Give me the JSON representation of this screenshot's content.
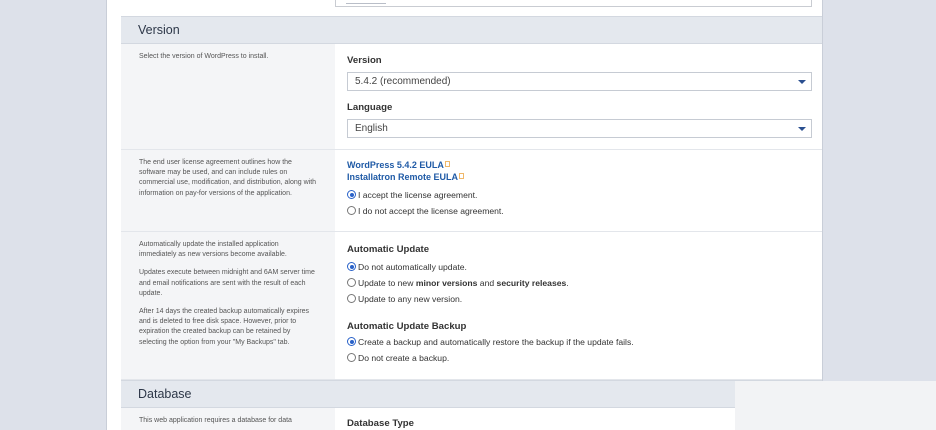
{
  "version_section": {
    "title": "Version",
    "description": "Select the version of WordPress to install.",
    "version_label": "Version",
    "version_value": "5.4.2 (recommended)",
    "language_label": "Language",
    "language_value": "English"
  },
  "license": {
    "description": "The end user license agreement outlines how the software may be used, and can include rules on commercial use, modification, and distribution, along with information on pay-for versions of the application.",
    "eula_link": "WordPress 5.4.2 EULA",
    "remote_eula_link": "Installatron Remote EULA",
    "accept": "I accept the license agreement.",
    "decline": "I do not accept the license agreement."
  },
  "auto_update": {
    "desc1": "Automatically update the installed application immediately as new versions become available.",
    "desc2": "Updates execute between midnight and 6AM server time and email notifications are sent with the result of each update.",
    "desc3": "After 14 days the created backup automatically expires and is deleted to free disk space. However, prior to expiration the created backup can be retained by selecting the option from your \"My Backups\" tab.",
    "label": "Automatic Update",
    "opt1": "Do not automatically update.",
    "opt2_pre": "Update to new ",
    "opt2_bold": "minor versions",
    "opt2_mid": " and ",
    "opt2_bold2": "security releases",
    "opt2_post": ".",
    "opt3": "Update to any new version.",
    "backup_label": "Automatic Update Backup",
    "backup_opt1": "Create a backup and automatically restore the backup if the update fails.",
    "backup_opt2": "Do not create a backup."
  },
  "database_section": {
    "title": "Database",
    "description": "This web application requires a database for data",
    "type_label": "Database Type"
  }
}
